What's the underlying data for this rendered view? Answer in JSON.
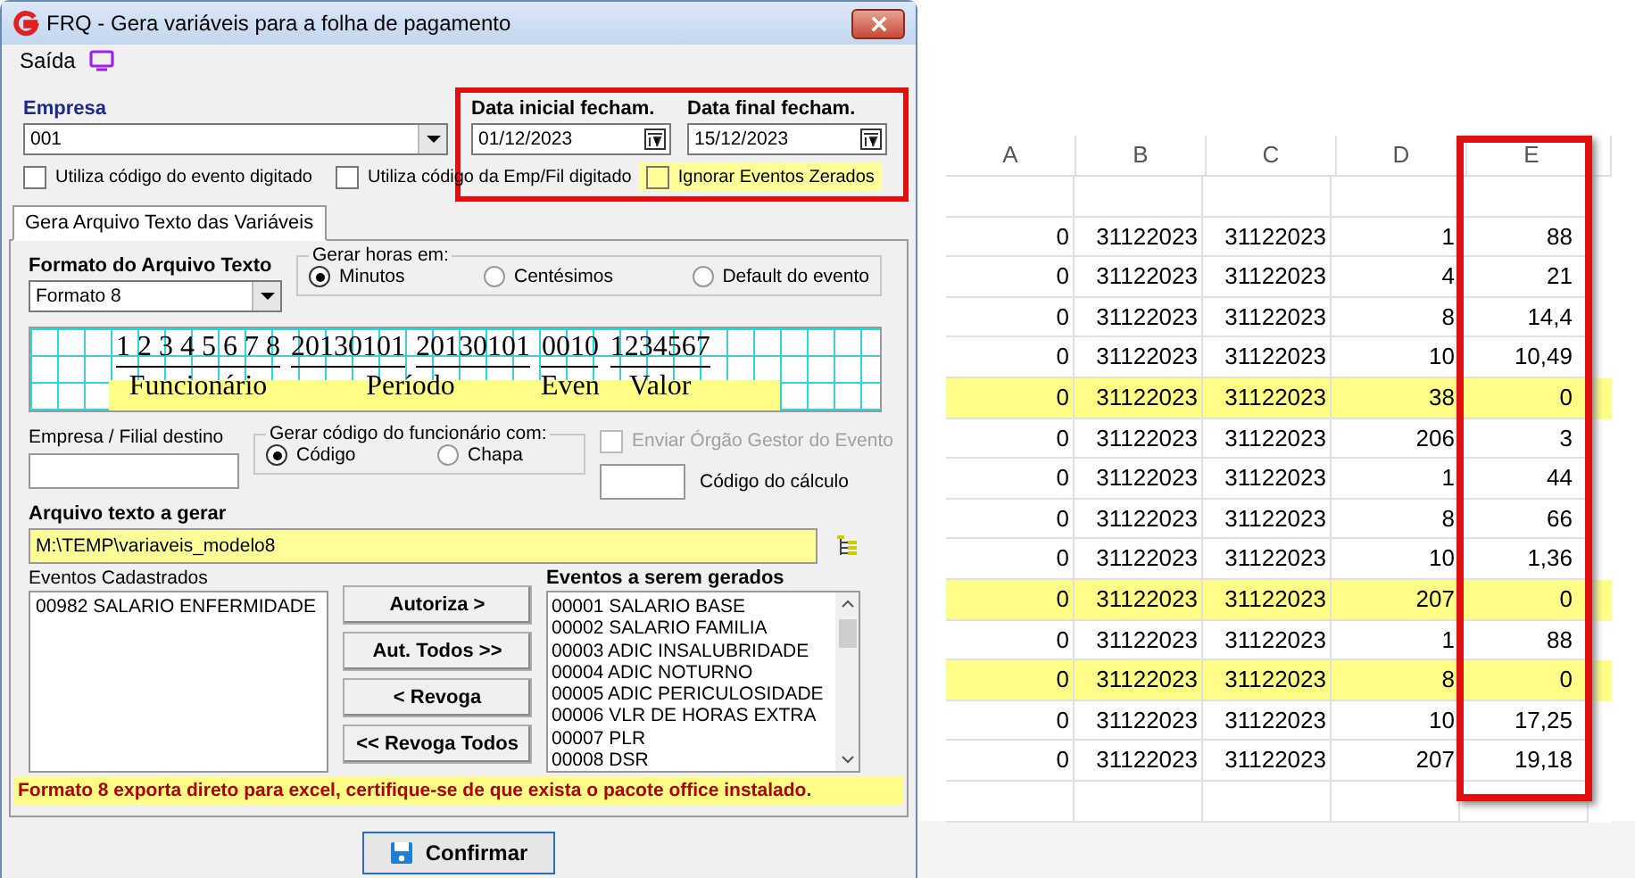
{
  "window": {
    "title": "FRQ - Gera variáveis para a folha de pagamento"
  },
  "menu": [
    {
      "label": "Saída"
    }
  ],
  "empresa": {
    "label": "Empresa",
    "value": "001"
  },
  "date_start": {
    "label": "Data inicial fecham.",
    "value": "01/12/2023"
  },
  "date_end": {
    "label": "Data final fecham.",
    "value": "15/12/2023"
  },
  "period_frame": {
    "outlined": true
  },
  "options": [
    {
      "label": "Utiliza código do evento digitado",
      "checked": false,
      "highlighted": false
    },
    {
      "label": "Utiliza código da Emp/Fil digitado",
      "checked": false,
      "highlighted": false
    },
    {
      "label": "Ignorar Eventos Zerados",
      "checked": false,
      "highlighted": true
    }
  ],
  "tabs": [
    {
      "label": "Gera Arquivo Texto das Variáveis",
      "selected": true
    }
  ],
  "format": {
    "label": "Formato do Arquivo Texto",
    "value": "Formato 8"
  },
  "hours_group": {
    "title": "Gerar horas em:",
    "options": [
      {
        "label": "Minutos",
        "selected": true
      },
      {
        "label": "Centésimos",
        "selected": false
      },
      {
        "label": "Default do evento",
        "selected": false
      }
    ]
  },
  "layout_preview": {
    "fields": [
      {
        "label": "Funcionário",
        "codes": [
          "1 2 3 4 5 6 7 8"
        ]
      },
      {
        "label": "Período",
        "codes": [
          "20130101",
          "20130101"
        ]
      },
      {
        "label": "Even",
        "codes": [
          "0010"
        ]
      },
      {
        "label": "Valor",
        "codes": [
          "1234567"
        ]
      }
    ]
  },
  "destino": {
    "label": "Empresa / Filial destino"
  },
  "code_group": {
    "title": "Gerar código do funcionário com:",
    "options": [
      {
        "label": "Código",
        "selected": true
      },
      {
        "label": "Chapa",
        "selected": false
      }
    ]
  },
  "enviar": {
    "label": "Enviar Órgão Gestor do Evento",
    "checked": false,
    "disabled": true
  },
  "calc_code": {
    "label": "Código do cálculo"
  },
  "arquivo": {
    "label": "Arquivo texto a gerar",
    "value": "M:\\TEMP\\variaveis_modelo8"
  },
  "eventos_cadastrados": {
    "label": "Eventos Cadastrados",
    "items": [
      "00982 SALARIO ENFERMIDADE"
    ]
  },
  "transfer_buttons": [
    "Autoriza >",
    "Aut. Todos >>",
    "< Revoga",
    "<< Revoga Todos"
  ],
  "eventos_gerados": {
    "label": "Eventos a serem gerados",
    "items": [
      "00001 SALARIO BASE",
      "00002 SALARIO FAMILIA",
      "00003 ADIC INSALUBRIDADE",
      "00004 ADIC NOTURNO",
      "00005 ADIC PERICULOSIDADE",
      "00006 VLR DE HORAS EXTRA",
      "00007 PLR",
      "00008 DSR"
    ]
  },
  "warning": "Formato 8 exporta direto para excel, certifique-se de que exista o pacote office instalado.",
  "confirm_button": "Confirmar",
  "sheet": {
    "columns": [
      {
        "label": "A",
        "outlined": false
      },
      {
        "label": "B",
        "outlined": false
      },
      {
        "label": "C",
        "outlined": false
      },
      {
        "label": "D",
        "outlined": false
      },
      {
        "label": "E",
        "outlined": true
      }
    ],
    "rows": [
      {
        "cells": [
          "0",
          "31122023",
          "31122023",
          "1",
          "88"
        ],
        "highlighted": false
      },
      {
        "cells": [
          "0",
          "31122023",
          "31122023",
          "4",
          "21"
        ],
        "highlighted": false
      },
      {
        "cells": [
          "0",
          "31122023",
          "31122023",
          "8",
          "14,4"
        ],
        "highlighted": false
      },
      {
        "cells": [
          "0",
          "31122023",
          "31122023",
          "10",
          "10,49"
        ],
        "highlighted": false
      },
      {
        "cells": [
          "0",
          "31122023",
          "31122023",
          "38",
          "0"
        ],
        "highlighted": true
      },
      {
        "cells": [
          "0",
          "31122023",
          "31122023",
          "206",
          "3"
        ],
        "highlighted": false
      },
      {
        "cells": [
          "0",
          "31122023",
          "31122023",
          "1",
          "44"
        ],
        "highlighted": false
      },
      {
        "cells": [
          "0",
          "31122023",
          "31122023",
          "8",
          "66"
        ],
        "highlighted": false
      },
      {
        "cells": [
          "0",
          "31122023",
          "31122023",
          "10",
          "1,36"
        ],
        "highlighted": false
      },
      {
        "cells": [
          "0",
          "31122023",
          "31122023",
          "207",
          "0"
        ],
        "highlighted": true
      },
      {
        "cells": [
          "0",
          "31122023",
          "31122023",
          "1",
          "88"
        ],
        "highlighted": false
      },
      {
        "cells": [
          "0",
          "31122023",
          "31122023",
          "8",
          "0"
        ],
        "highlighted": true
      },
      {
        "cells": [
          "0",
          "31122023",
          "31122023",
          "10",
          "17,25"
        ],
        "highlighted": false
      },
      {
        "cells": [
          "0",
          "31122023",
          "31122023",
          "207",
          "19,18"
        ],
        "highlighted": false
      }
    ]
  }
}
